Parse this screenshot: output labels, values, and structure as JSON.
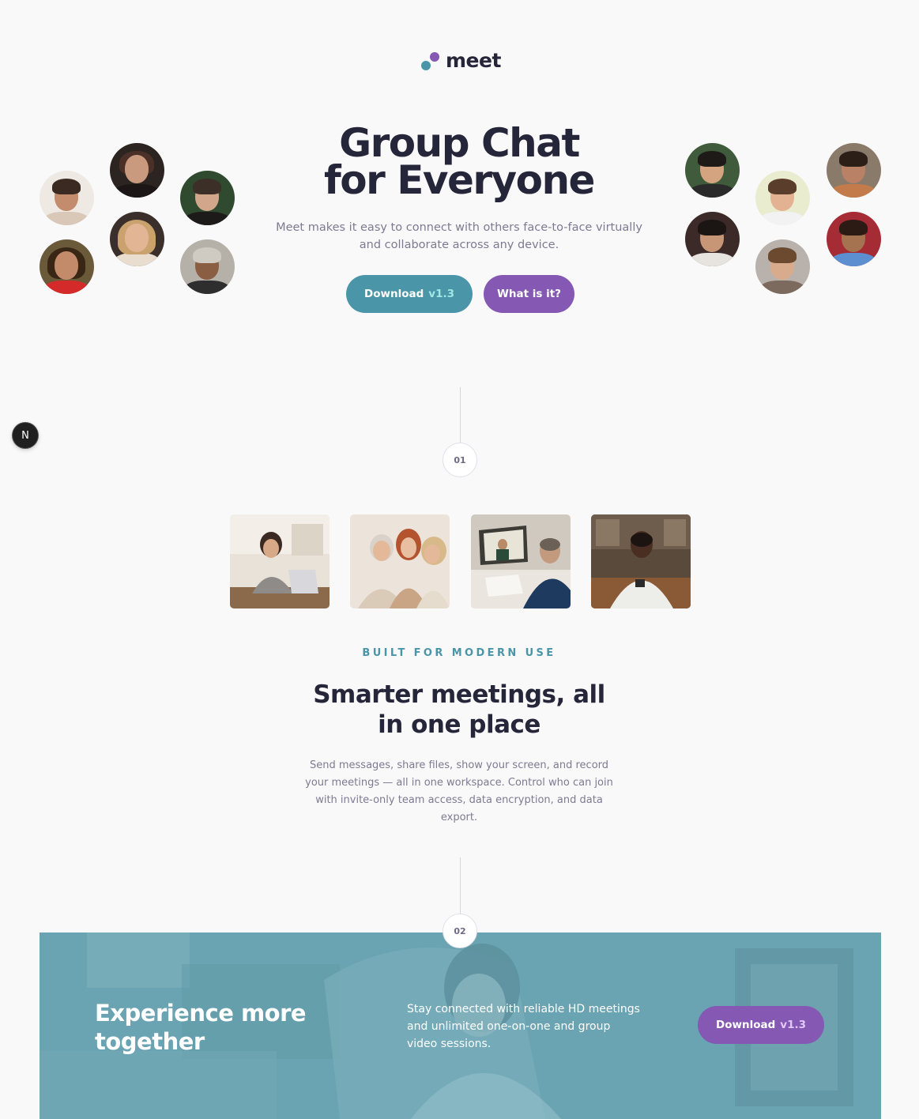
{
  "brand": {
    "name": "meet",
    "colors": {
      "teal": "#4a95a8",
      "purple": "#8458b3",
      "text": "#26263a",
      "muted": "#7e7a92",
      "background": "#f9f9fa"
    }
  },
  "hero": {
    "title_line1": "Group Chat",
    "title_line2": "for Everyone",
    "subtitle": "Meet makes it easy to connect with others face-to-face virtually and collaborate across any device.",
    "download_label": "Download",
    "download_version": "v1.3",
    "what_label": "What is it?"
  },
  "avatars": {
    "left_count": 6,
    "right_count": 6
  },
  "steps": {
    "first": "01",
    "second": "02"
  },
  "features": {
    "photos": [
      "woman-with-laptop-photo",
      "friends-with-phone-photo",
      "video-call-laptop-photo",
      "man-with-phone-photo"
    ],
    "eyebrow": "BUILT FOR MODERN USE",
    "title": "Smarter meetings, all in one place",
    "body": "Send messages, share files, show your screen, and record your meetings — all in one workspace. Control who can join with invite-only team access, data encryption, and data export."
  },
  "banner": {
    "title": "Experience more together",
    "text": "Stay connected with reliable HD meetings and unlimited one-on-one and group video sessions.",
    "download_label": "Download",
    "download_version": "v1.3"
  },
  "dev_badge": {
    "letter": "N",
    "icon": "nextjs-icon"
  }
}
